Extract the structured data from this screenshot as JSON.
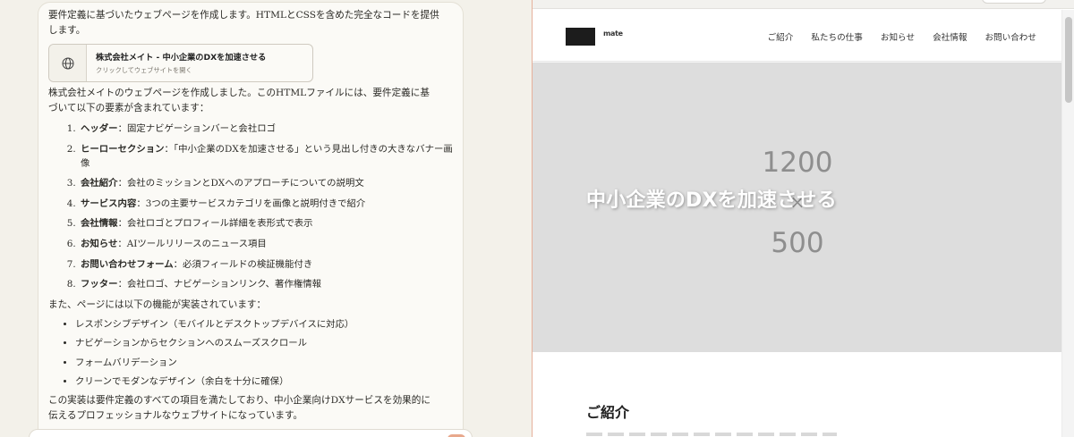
{
  "chat": {
    "intro": "要件定義に基づいたウェブページを作成します。HTMLとCSSを含めた完全なコードを提供します。",
    "artifact": {
      "title": "株式会社メイト - 中小企業のDXを加速させる",
      "subtitle": "クリックしてウェブサイトを開く",
      "icon": "globe-icon"
    },
    "summary": "株式会社メイトのウェブページを作成しました。このHTMLファイルには、要件定義に基づいて以下の要素が含まれています：",
    "features": [
      {
        "label": "ヘッダー",
        "desc": "：固定ナビゲーションバーと会社ロゴ"
      },
      {
        "label": "ヒーローセクション",
        "desc": "：「中小企業のDXを加速させる」という見出し付きの大きなバナー画像"
      },
      {
        "label": "会社紹介",
        "desc": "：会社のミッションとDXへのアプローチについての説明文"
      },
      {
        "label": "サービス内容",
        "desc": "：3つの主要サービスカテゴリを画像と説明付きで紹介"
      },
      {
        "label": "会社情報",
        "desc": "：会社ロゴとプロフィール詳細を表形式で表示"
      },
      {
        "label": "お知らせ",
        "desc": "：AIツールリリースのニュース項目"
      },
      {
        "label": "お問い合わせフォーム",
        "desc": "：必須フィールドの検証機能付き"
      },
      {
        "label": "フッター",
        "desc": "：会社ロゴ、ナビゲーションリンク、著作権情報"
      }
    ],
    "also": "また、ページには以下の機能が実装されています：",
    "bullets": [
      "レスポンシブデザイン（モバイルとデスクトップデバイスに対応）",
      "ナビゲーションからセクションへのスムーズスクロール",
      "フォームバリデーション",
      "クリーンでモダンなデザイン（余白を十分に確保）"
    ],
    "closing": "この実装は要件定義のすべての項目を満たしており、中小企業向けDXサービスを効果的に伝えるプロフェッショナルなウェブサイトになっています。"
  },
  "preview": {
    "logo_text": "mate",
    "nav": [
      "ご紹介",
      "私たちの仕事",
      "お知らせ",
      "会社情報",
      "お問い合わせ"
    ],
    "hero_placeholder": {
      "width": "1200",
      "times": "×",
      "height": "500"
    },
    "hero_title": "中小企業のDXを加速させる",
    "section_title": "ご紹介"
  },
  "colors": {
    "chat_bg": "#f3f1ea",
    "card_bg": "#fbfaf6",
    "hero_bg": "#dddddd",
    "accent": "#e7b19b"
  }
}
